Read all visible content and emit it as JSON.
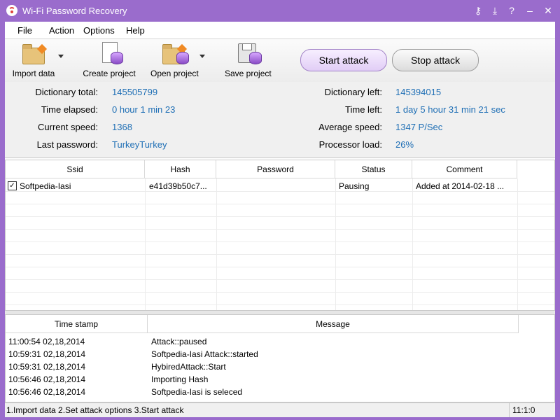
{
  "window": {
    "title": "Wi-Fi Password Recovery",
    "controls": {
      "key": "⚷",
      "download": "⤓",
      "help": "?",
      "minimize": "–",
      "close": "✕"
    }
  },
  "menu": {
    "file": "File",
    "action": "Action",
    "options": "Options",
    "help": "Help"
  },
  "toolbar": {
    "import": "Import data",
    "create": "Create project",
    "open": "Open project",
    "save": "Save project",
    "start": "Start attack",
    "stop": "Stop attack"
  },
  "stats": {
    "dict_total_label": "Dictionary total:",
    "dict_total": "145505799",
    "elapsed_label": "Time elapsed:",
    "elapsed": "0 hour 1 min 23",
    "speed_label": "Current speed:",
    "speed": "1368",
    "last_pw_label": "Last password:",
    "last_pw": "TurkeyTurkey",
    "dict_left_label": "Dictionary left:",
    "dict_left": "145394015",
    "time_left_label": "Time left:",
    "time_left": "1 day 5 hour 31 min 21 sec",
    "avg_speed_label": "Average speed:",
    "avg_speed": "1347 P/Sec",
    "cpu_label": "Processor load:",
    "cpu": "26%"
  },
  "table": {
    "headers": {
      "ssid": "Ssid",
      "hash": "Hash",
      "password": "Password",
      "status": "Status",
      "comment": "Comment"
    },
    "rows": [
      {
        "checked": "✓",
        "ssid": "Softpedia-Iasi",
        "hash": "e41d39b50c7...",
        "password": "",
        "status": "Pausing",
        "comment": "Added at 2014-02-18 ..."
      }
    ]
  },
  "log": {
    "headers": {
      "time": "Time stamp",
      "message": "Message"
    },
    "rows": [
      {
        "time": "11:00:54   02,18,2014",
        "message": "Attack::paused"
      },
      {
        "time": "10:59:31   02,18,2014",
        "message": "Softpedia-Iasi Attack::started"
      },
      {
        "time": "10:59:31   02,18,2014",
        "message": "HybiredAttack::Start"
      },
      {
        "time": "10:56:46   02,18,2014",
        "message": "Importing Hash"
      },
      {
        "time": "10:56:46   02,18,2014",
        "message": "Softpedia-Iasi is seleced"
      }
    ]
  },
  "statusbar": {
    "steps": "1.Import data  2.Set attack options  3.Start attack",
    "pos": "11:1:0"
  }
}
